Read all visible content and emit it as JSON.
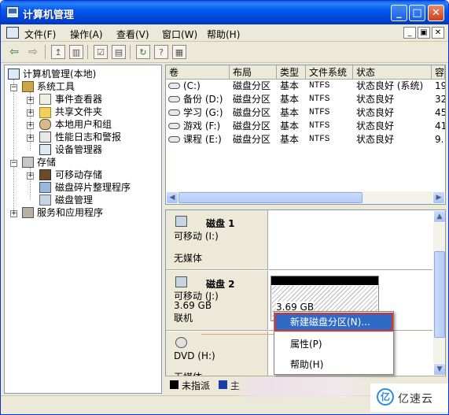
{
  "window": {
    "title": "计算机管理",
    "buttons": {
      "minimize": "_",
      "maximize": "□",
      "close": "✕"
    }
  },
  "menubar": {
    "items": [
      "文件(F)",
      "操作(A)",
      "查看(V)",
      "窗口(W)",
      "帮助(H)"
    ],
    "mdi": {
      "minimize": "_",
      "restore": "▣",
      "close": "✕"
    }
  },
  "toolbar": {
    "icons": [
      "back-arrow-icon",
      "forward-arrow-icon",
      "up-folder-icon",
      "show-tree-icon",
      "properties-icon",
      "export-list-icon",
      "refresh-icon",
      "help-icon",
      "help-topics-icon"
    ]
  },
  "tree": {
    "root": "计算机管理(本地)",
    "system_tools": "系统工具",
    "event_viewer": "事件查看器",
    "shared_folders": "共享文件夹",
    "local_users": "本地用户和组",
    "perf_logs": "性能日志和警报",
    "device_manager": "设备管理器",
    "storage": "存储",
    "removable_storage": "可移动存储",
    "defrag": "磁盘碎片整理程序",
    "disk_mgmt": "磁盘管理",
    "services_apps": "服务和应用程序",
    "expander_plus": "+",
    "expander_minus": "−"
  },
  "volume_list": {
    "columns": [
      "卷",
      "布局",
      "类型",
      "文件系统",
      "状态",
      "容"
    ],
    "rows": [
      {
        "volume": "(C:)",
        "layout": "磁盘分区",
        "type": "基本",
        "fs": "NTFS",
        "status": "状态良好 (系统)",
        "cap": "19"
      },
      {
        "volume": "备份 (D:)",
        "layout": "磁盘分区",
        "type": "基本",
        "fs": "NTFS",
        "status": "状态良好",
        "cap": "32"
      },
      {
        "volume": "学习 (G:)",
        "layout": "磁盘分区",
        "type": "基本",
        "fs": "NTFS",
        "status": "状态良好",
        "cap": "45"
      },
      {
        "volume": "游戏 (F:)",
        "layout": "磁盘分区",
        "type": "基本",
        "fs": "NTFS",
        "status": "状态良好",
        "cap": "41"
      },
      {
        "volume": "课程 (E:)",
        "layout": "磁盘分区",
        "type": "基本",
        "fs": "NTFS",
        "status": "状态良好",
        "cap": "9."
      }
    ]
  },
  "disks": [
    {
      "name": "磁盘 1",
      "kind": "可移动 (I:)",
      "size": "",
      "state": "无媒体"
    },
    {
      "name": "磁盘 2",
      "kind": "可移动 (J:)",
      "size": "3.69 GB",
      "state": "联机",
      "partition_size": "3.69 GB"
    },
    {
      "name": "",
      "kind": "DVD (H:)",
      "size": "",
      "state": "无媒体"
    }
  ],
  "legend": {
    "unallocated": "未指派",
    "primary": "主"
  },
  "context_menu": {
    "items": [
      "新建磁盘分区(N)...",
      "属性(P)",
      "帮助(H)"
    ]
  },
  "watermark": {
    "logo": "亿",
    "text": "亿速云"
  },
  "colors": {
    "title_blue": "#0058ee",
    "highlight": "#316ac5",
    "callout_red": "#e0312b"
  }
}
